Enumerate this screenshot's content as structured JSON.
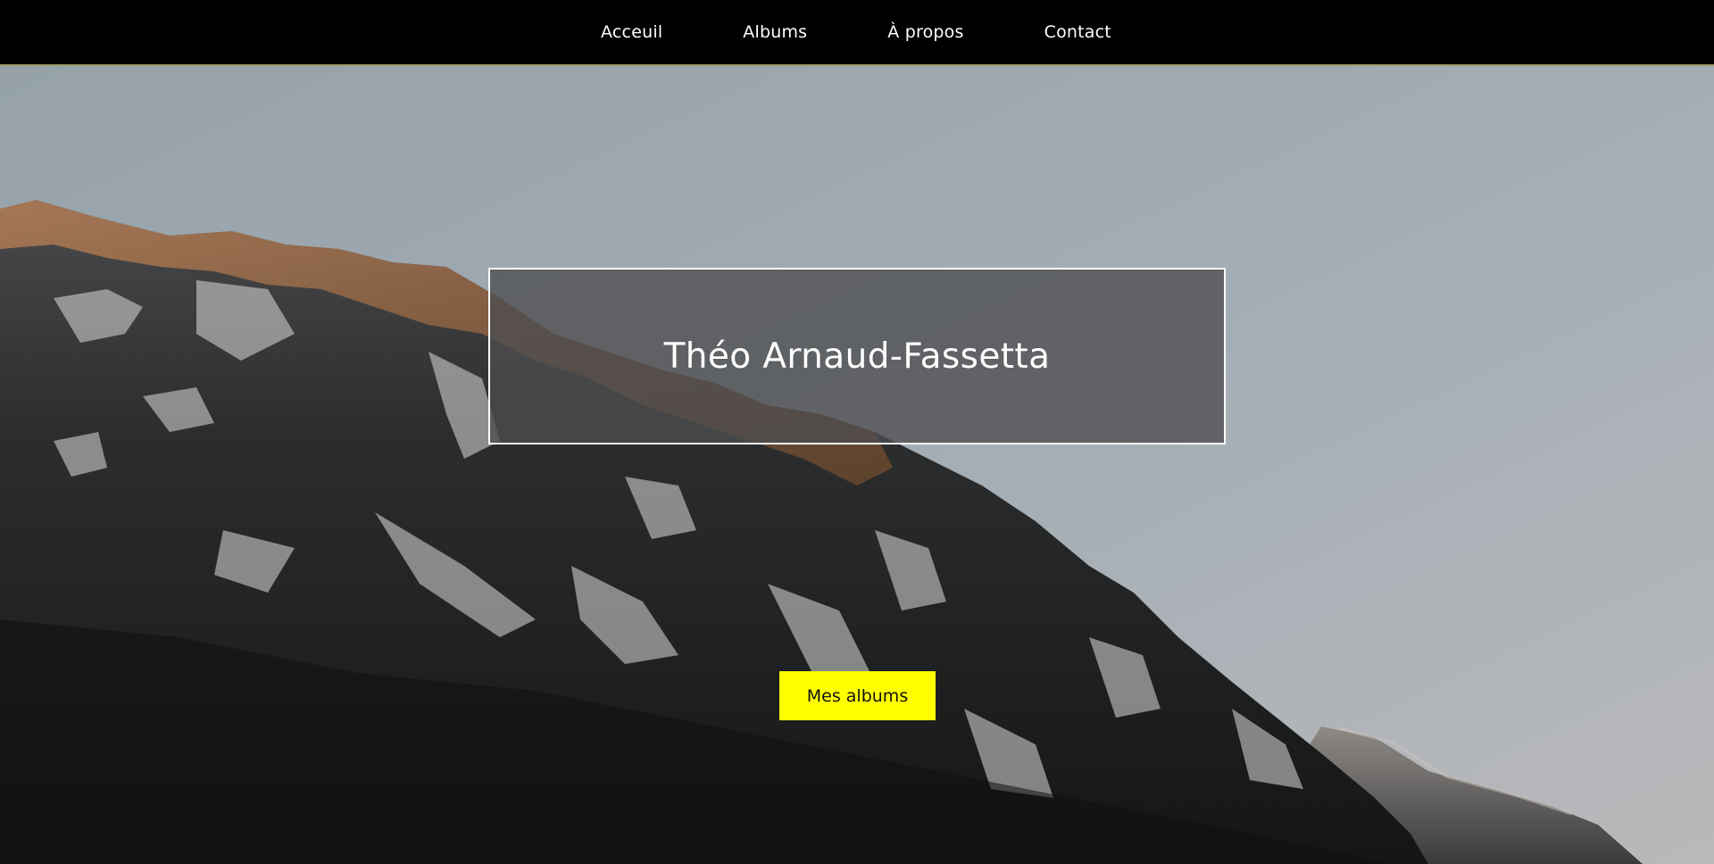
{
  "nav": {
    "items": [
      {
        "label": "Acceuil"
      },
      {
        "label": "Albums"
      },
      {
        "label": "À propos"
      },
      {
        "label": "Contact"
      }
    ]
  },
  "hero": {
    "title": "Théo Arnaud-Fassetta",
    "cta_label": "Mes albums",
    "photo_subject": "snowy forested mountain slope at golden hour",
    "colors": {
      "cta_background": "#ffff00",
      "nav_background": "#000000",
      "nav_border": "#9a9a66",
      "title_box_fill": "#4d4d4f"
    }
  }
}
